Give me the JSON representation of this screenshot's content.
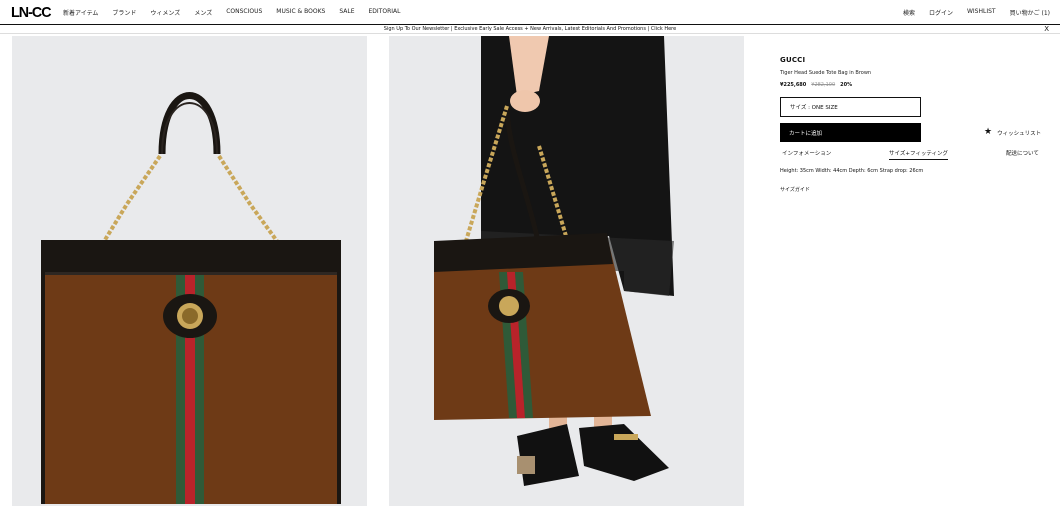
{
  "header": {
    "logo": "LN-CC",
    "nav": [
      "新着アイテム",
      "ブランド",
      "ウィメンズ",
      "メンズ",
      "CONSCIOUS",
      "MUSIC & BOOKS",
      "SALE",
      "EDITORIAL"
    ],
    "right_nav": [
      "検索",
      "ログイン",
      "WISHLIST",
      "買い物かご (1)"
    ]
  },
  "banner": {
    "text": "Sign Up To Our Newsletter | Exclusive Early Sale Access + New Arrivals, Latest Editorials And Promotions | Click Here",
    "close": "X"
  },
  "product": {
    "brand": "GUCCI",
    "name": "Tiger Head Suede Tote Bag in Brown",
    "price_sale": "¥225,680",
    "price_original": "¥282,100",
    "discount": "20%",
    "size_label": "サイズ : ONE SIZE",
    "add_to_cart": "カートに追加",
    "wishlist": "ウィッシュリスト",
    "tabs": [
      "インフォメーション",
      "サイズ+フィッティング",
      "配送について"
    ],
    "active_tab": 1,
    "details": "Height: 35cm Width: 44cm Depth: 6cm Strap drop: 26cm",
    "size_guide": "サイズガイド"
  },
  "colors": {
    "suede": "#6e3a16",
    "leather": "#1a1612",
    "stripe_green": "#2f5a38",
    "stripe_red": "#b8232a",
    "chain": "#c9a75a",
    "panel_bg": "#e9eaec"
  }
}
